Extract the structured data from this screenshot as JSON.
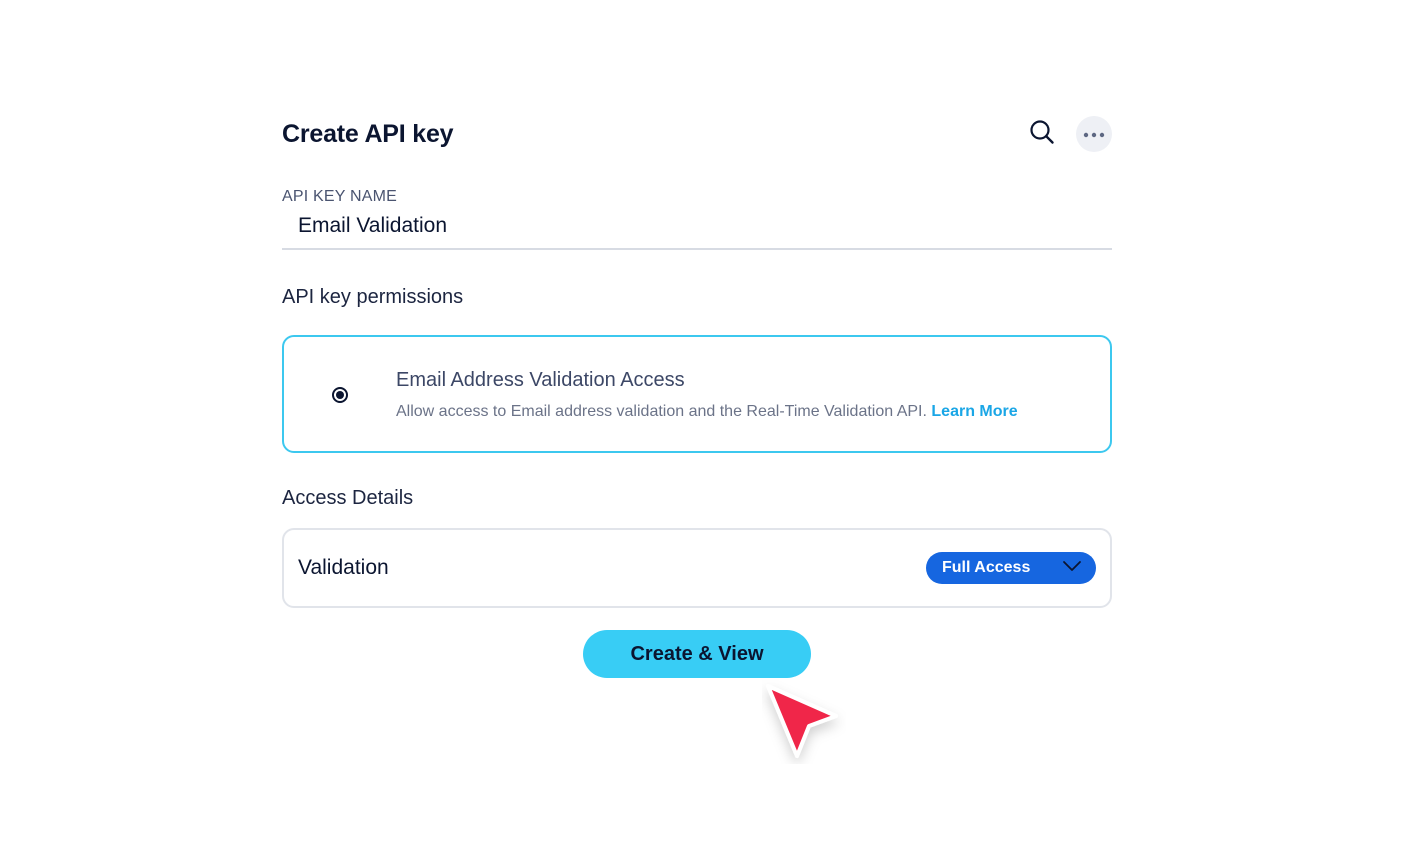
{
  "header": {
    "title": "Create API key",
    "search_icon": "search-icon",
    "more_icon": "more-horizontal-icon"
  },
  "api_key_name": {
    "label": "API KEY NAME",
    "value": "Email Validation"
  },
  "permissions": {
    "section_title": "API key permissions",
    "option": {
      "title": "Email Address Validation Access",
      "description": "Allow access to Email address validation and the Real-Time Validation API.",
      "link_label": "Learn More",
      "selected": true
    }
  },
  "access_details": {
    "section_title": "Access Details",
    "row_label": "Validation",
    "selected_access": "Full Access",
    "dropdown_icon": "chevron-down-icon"
  },
  "actions": {
    "create_label": "Create & View"
  },
  "colors": {
    "accent_cyan": "#38cdf5",
    "card_border_selected": "#3cc8ef",
    "select_blue": "#1666e0",
    "link_blue": "#1aa6e6",
    "cursor_red": "#f0284a"
  }
}
